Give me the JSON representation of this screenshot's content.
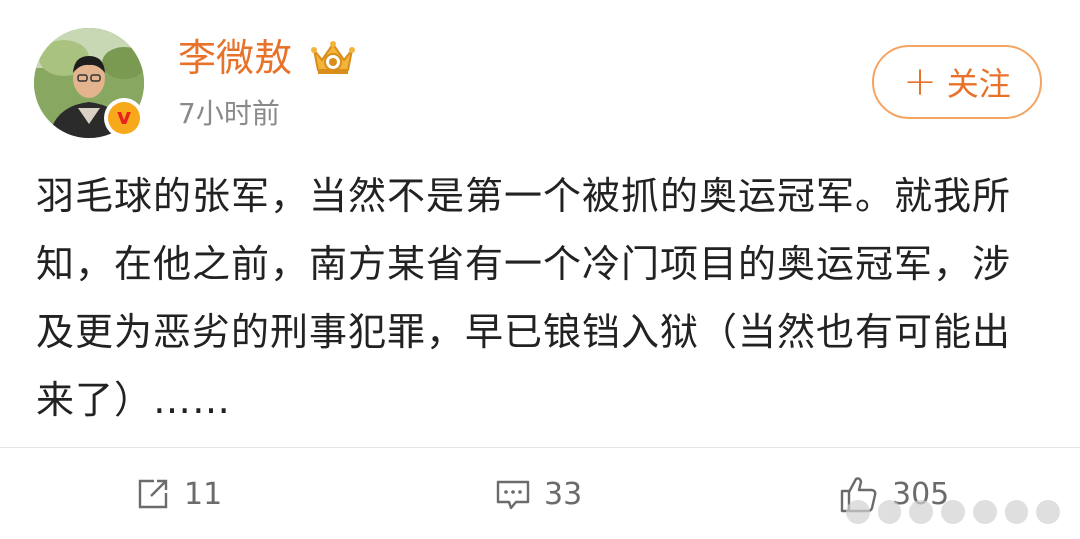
{
  "author": {
    "name": "李微敖",
    "verified_badge": "v",
    "time": "7小时前"
  },
  "follow_button": {
    "label": "关注",
    "icon": "plus-icon"
  },
  "post": {
    "text": "羽毛球的张军，当然不是第一个被抓的奥运冠军。就我所知，在他之前，南方某省有一个冷门项目的奥运冠军，涉及更为恶劣的刑事犯罪，早已锒铛入狱（当然也有可能出来了）……"
  },
  "actions": {
    "share": {
      "icon": "share-icon",
      "count": "11"
    },
    "comment": {
      "icon": "comment-icon",
      "count": "33"
    },
    "like": {
      "icon": "thumbs-up-icon",
      "count": "305"
    }
  },
  "colors": {
    "accent": "#e8722a",
    "follow_border": "#f4a463",
    "text": "#222222",
    "muted": "#8a8a8a",
    "action": "#6b6b6b"
  }
}
